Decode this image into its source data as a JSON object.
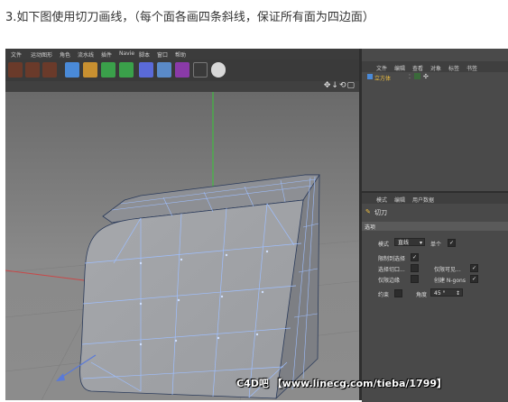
{
  "caption": "3.如下图使用切刀画线，（每个面各画四条斜线，保证所有面为四边面）",
  "menu": [
    "文件",
    "运动图形",
    "角色",
    "流水线",
    "插件",
    "Navie",
    "脚本",
    "窗口",
    "帮助"
  ],
  "object_manager": {
    "menu": [
      "文件",
      "编辑",
      "查看",
      "对象",
      "标签",
      "书签"
    ],
    "object_name": "立方体"
  },
  "attributes": {
    "tabs": [
      "模式",
      "编辑",
      "用户数据"
    ],
    "tool_name": "切刀",
    "section": "选项",
    "mode_label": "模式",
    "mode_value": "直线",
    "single_label": "单个",
    "restrict_label": "限制到选择",
    "visible_only_label": "选择切口...",
    "visible_only2_label": "仅限可见...",
    "edges_only_label": "仅限边缘",
    "ngons_label": "创建 N-gons",
    "constrain_label": "约束",
    "angle_label": "角度",
    "angle_value": "45 °"
  },
  "watermark": "C4D吧 【www.linecg.com/tieba/1799】",
  "colors": {
    "accent_object": "#f0c040",
    "mesh_edge": "#8fb4ff",
    "axis_green": "#38c838",
    "axis_red": "#c84848"
  }
}
